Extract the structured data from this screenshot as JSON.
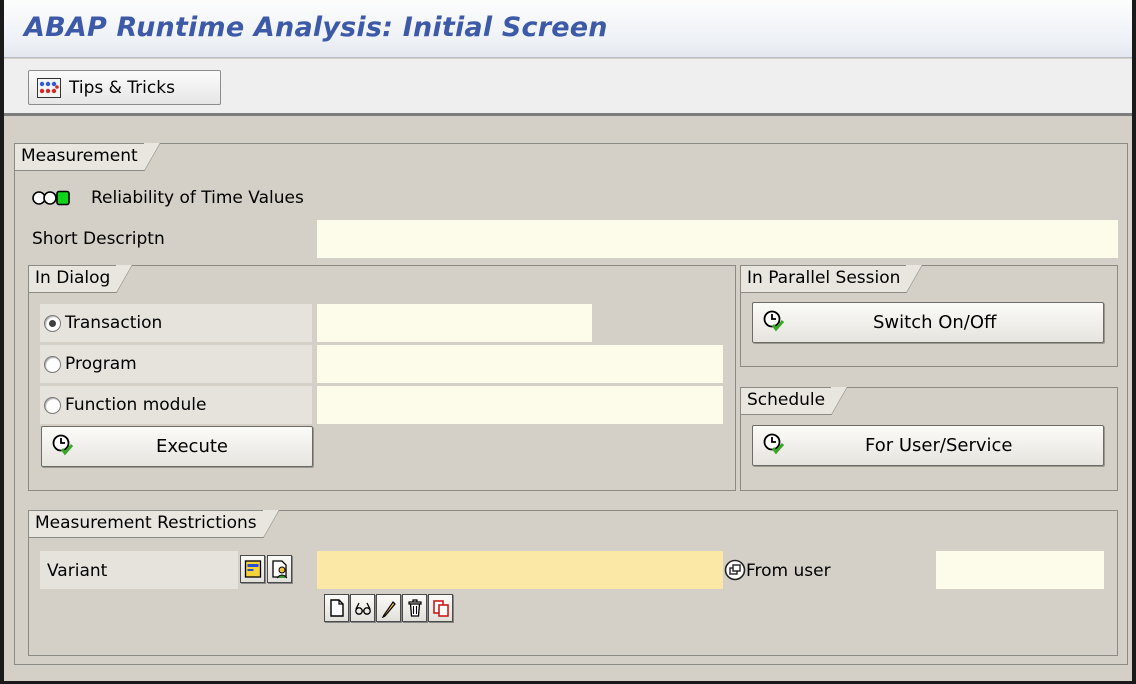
{
  "window": {
    "title": "ABAP Runtime Analysis: Initial Screen"
  },
  "appbar": {
    "tips_label": "Tips & Tricks",
    "tips_icon": "tips-tricks-icon"
  },
  "measurement": {
    "group_title": "Measurement",
    "reliability_label": "Reliability of Time Values",
    "reliability_icon": "traffic-light-green-icon",
    "short_description_label": "Short Descriptn",
    "short_description_value": ""
  },
  "in_dialog": {
    "group_title": "In Dialog",
    "options": [
      {
        "label": "Transaction",
        "selected": true,
        "value": ""
      },
      {
        "label": "Program",
        "selected": false,
        "value": ""
      },
      {
        "label": "Function module",
        "selected": false,
        "value": ""
      }
    ],
    "execute_label": "Execute"
  },
  "parallel_session": {
    "group_title": "In Parallel Session",
    "button_label": "Switch On/Off"
  },
  "schedule": {
    "group_title": "Schedule",
    "button_label": "For User/Service"
  },
  "restrictions": {
    "group_title": "Measurement Restrictions",
    "variant_label": "Variant",
    "variant_value": "",
    "from_user_label": "From user",
    "from_user_value": "",
    "variant_tools": [
      "create-icon",
      "display-icon",
      "change-icon",
      "delete-icon",
      "copy-icon"
    ]
  },
  "colors": {
    "title": "#3c5aa8",
    "background": "#d4d0c8",
    "input": "#fdfbea",
    "required_input": "#fbe8a6"
  }
}
